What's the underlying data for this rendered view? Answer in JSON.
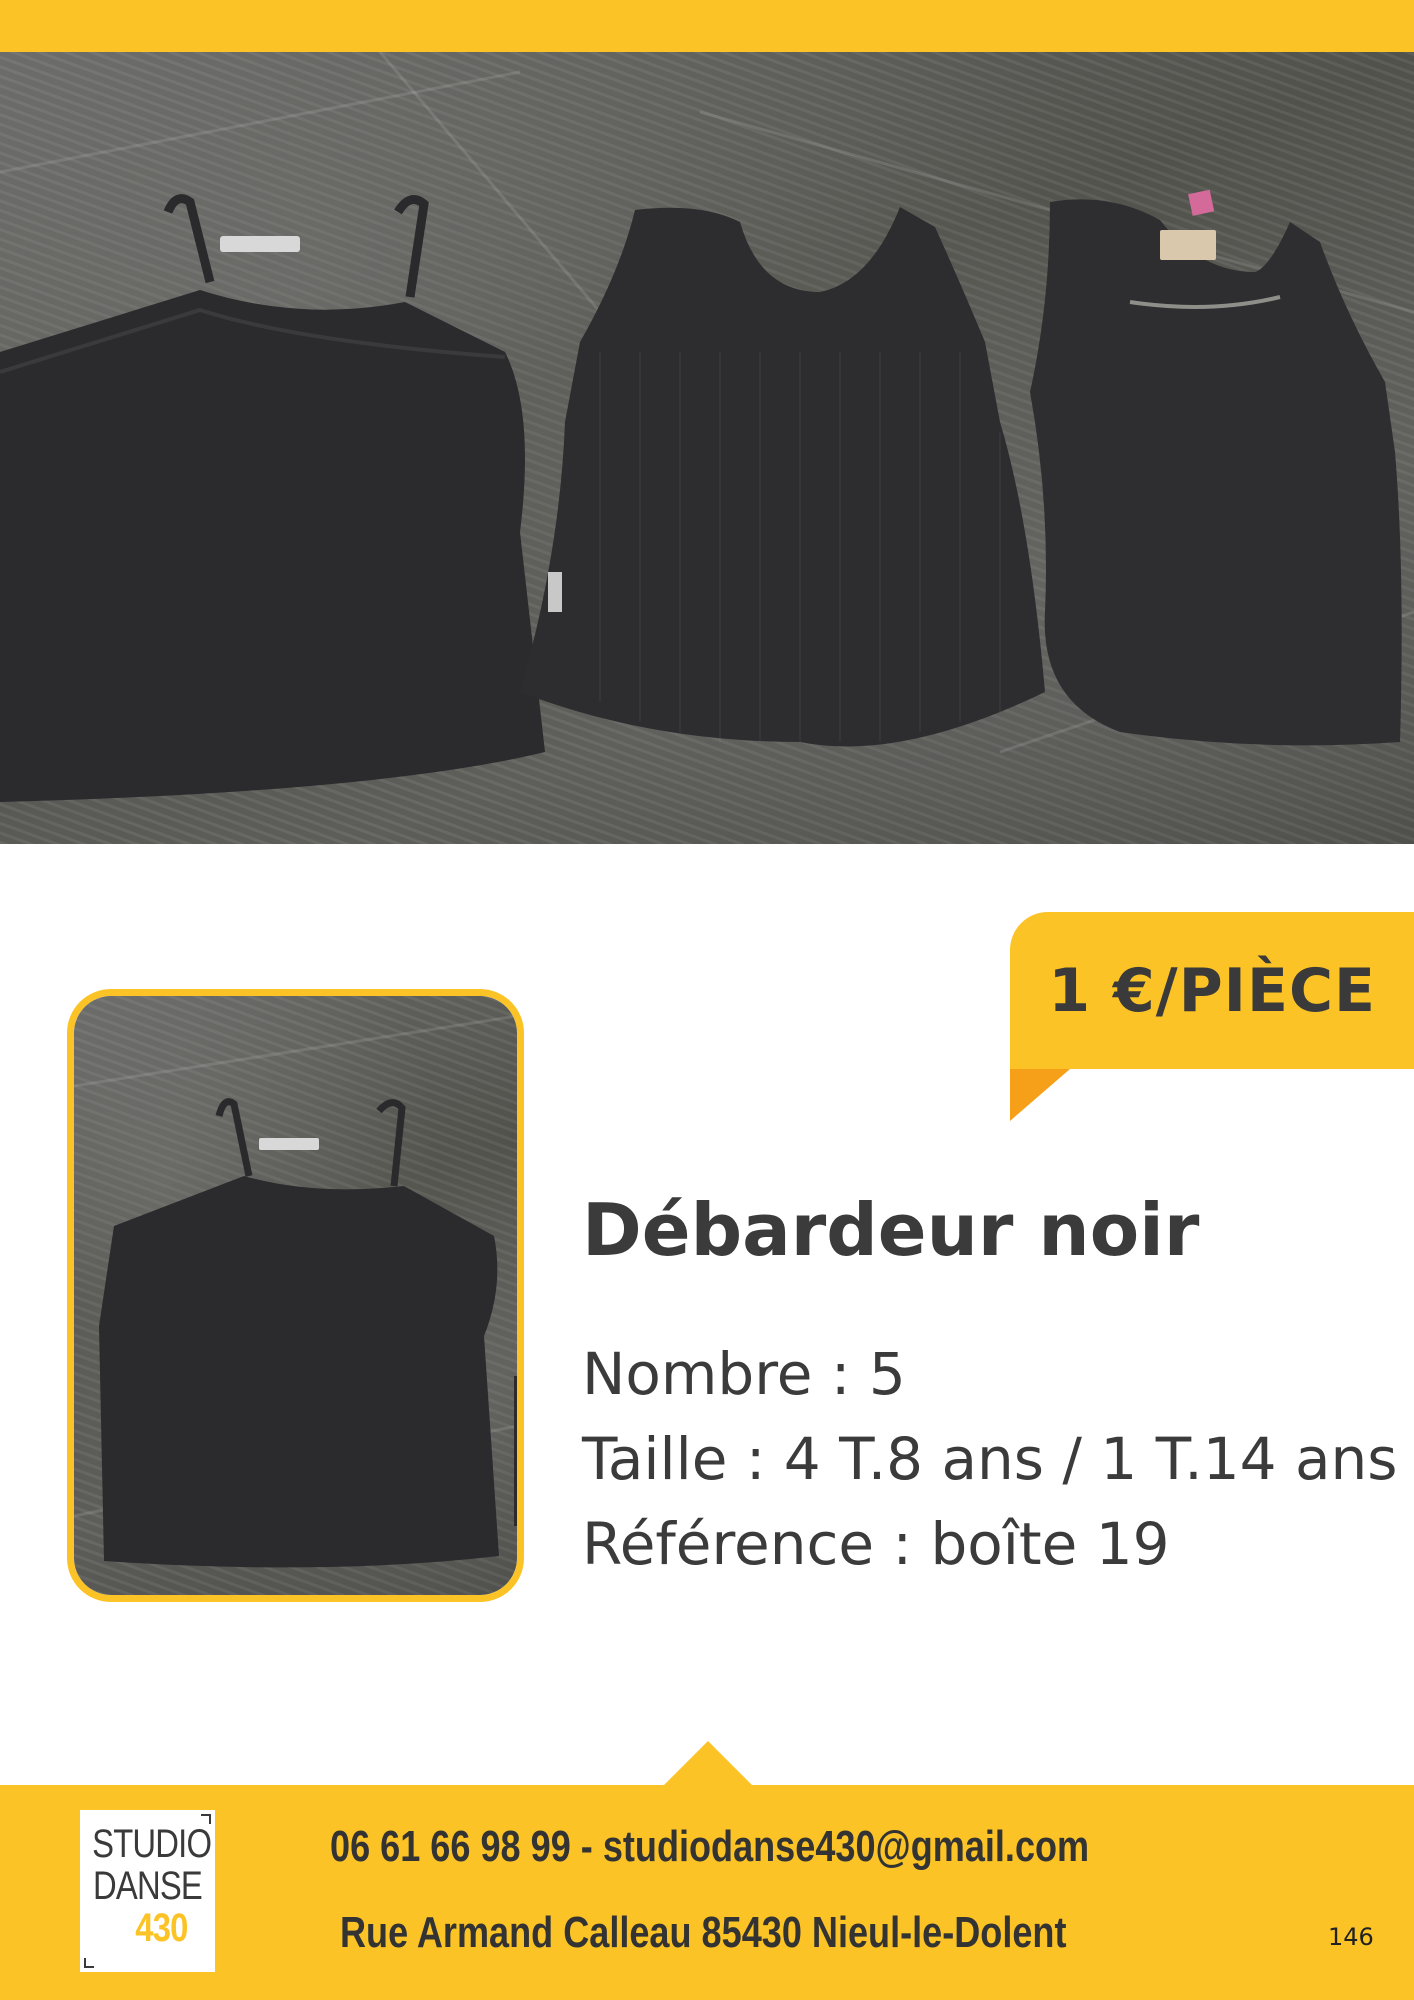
{
  "header": {
    "accent_color": "#fbc325"
  },
  "hero_photo": {
    "description_icon": "three-black-tank-tops-photo"
  },
  "price": {
    "label": "1 €/PIÈCE"
  },
  "product": {
    "title": "Débardeur noir",
    "count_line": "Nombre : 5",
    "size_line": "Taille : 4 T.8 ans / 1 T.14 ans",
    "reference_line": "Référence : boîte 19"
  },
  "footer": {
    "logo": {
      "line1": "STUDIO",
      "line2": "DANSE",
      "line3": "430"
    },
    "contact": "06 61 66 98 99 - studiodanse430@gmail.com",
    "address": "Rue Armand Calleau 85430 Nieul-le-Dolent",
    "page_number": "146"
  }
}
